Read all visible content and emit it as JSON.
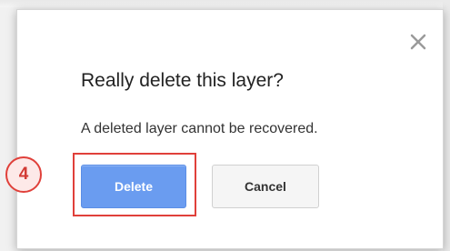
{
  "dialog": {
    "title": "Really delete this layer?",
    "message": "A deleted layer cannot be recovered.",
    "close_icon": "close-icon",
    "buttons": {
      "delete_label": "Delete",
      "cancel_label": "Cancel"
    }
  },
  "annotation": {
    "step_number": "4",
    "color": "#e0403a"
  },
  "colors": {
    "primary_button": "#6a9cf0",
    "secondary_button": "#f5f5f5"
  }
}
